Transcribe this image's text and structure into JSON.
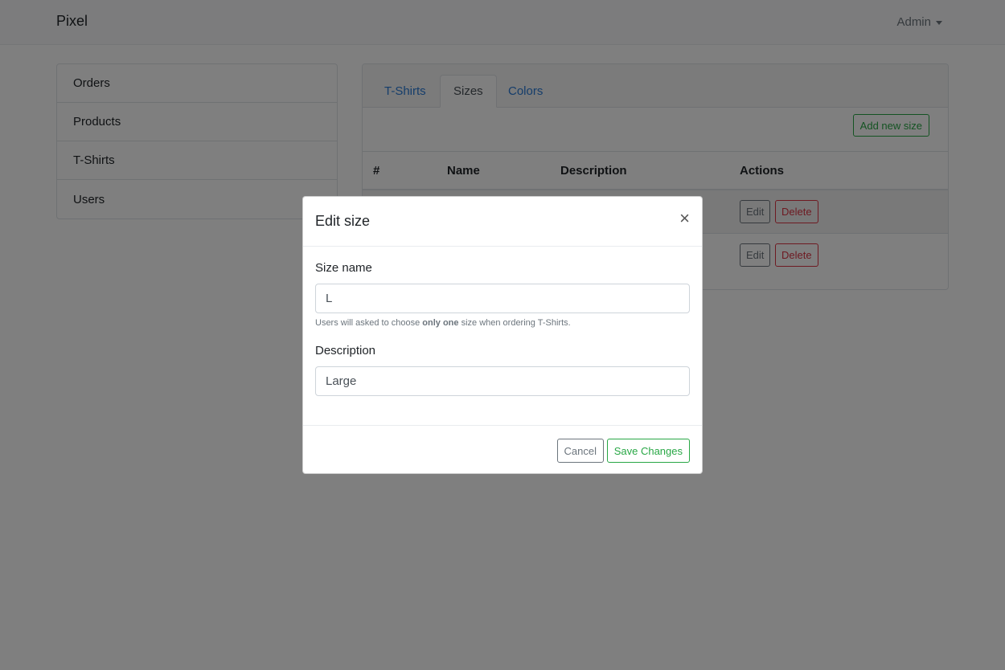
{
  "navbar": {
    "brand": "Pixel",
    "user_menu": "Admin"
  },
  "sidebar": {
    "items": [
      {
        "label": "Orders"
      },
      {
        "label": "Products"
      },
      {
        "label": "T-Shirts"
      },
      {
        "label": "Users"
      }
    ]
  },
  "tabs": [
    {
      "label": "T-Shirts",
      "active": false
    },
    {
      "label": "Sizes",
      "active": true
    },
    {
      "label": "Colors",
      "active": false
    }
  ],
  "toolbar": {
    "add_label": "Add new size"
  },
  "table": {
    "columns": [
      "#",
      "Name",
      "Description",
      "Actions"
    ],
    "rows": [
      {
        "edit_label": "Edit",
        "delete_label": "Delete"
      },
      {
        "edit_label": "Edit",
        "delete_label": "Delete"
      }
    ]
  },
  "modal": {
    "title": "Edit size",
    "close_symbol": "×",
    "size_name_label": "Size name",
    "size_name_value": "L",
    "help_prefix": "Users will asked to choose ",
    "help_bold": "only one",
    "help_suffix": " size when ordering T-Shirts.",
    "description_label": "Description",
    "description_value": "Large",
    "cancel_label": "Cancel",
    "save_label": "Save Changes"
  },
  "colors": {
    "link": "#2a7bd6",
    "success": "#28a745",
    "danger": "#dc3545",
    "secondary": "#6c757d"
  }
}
